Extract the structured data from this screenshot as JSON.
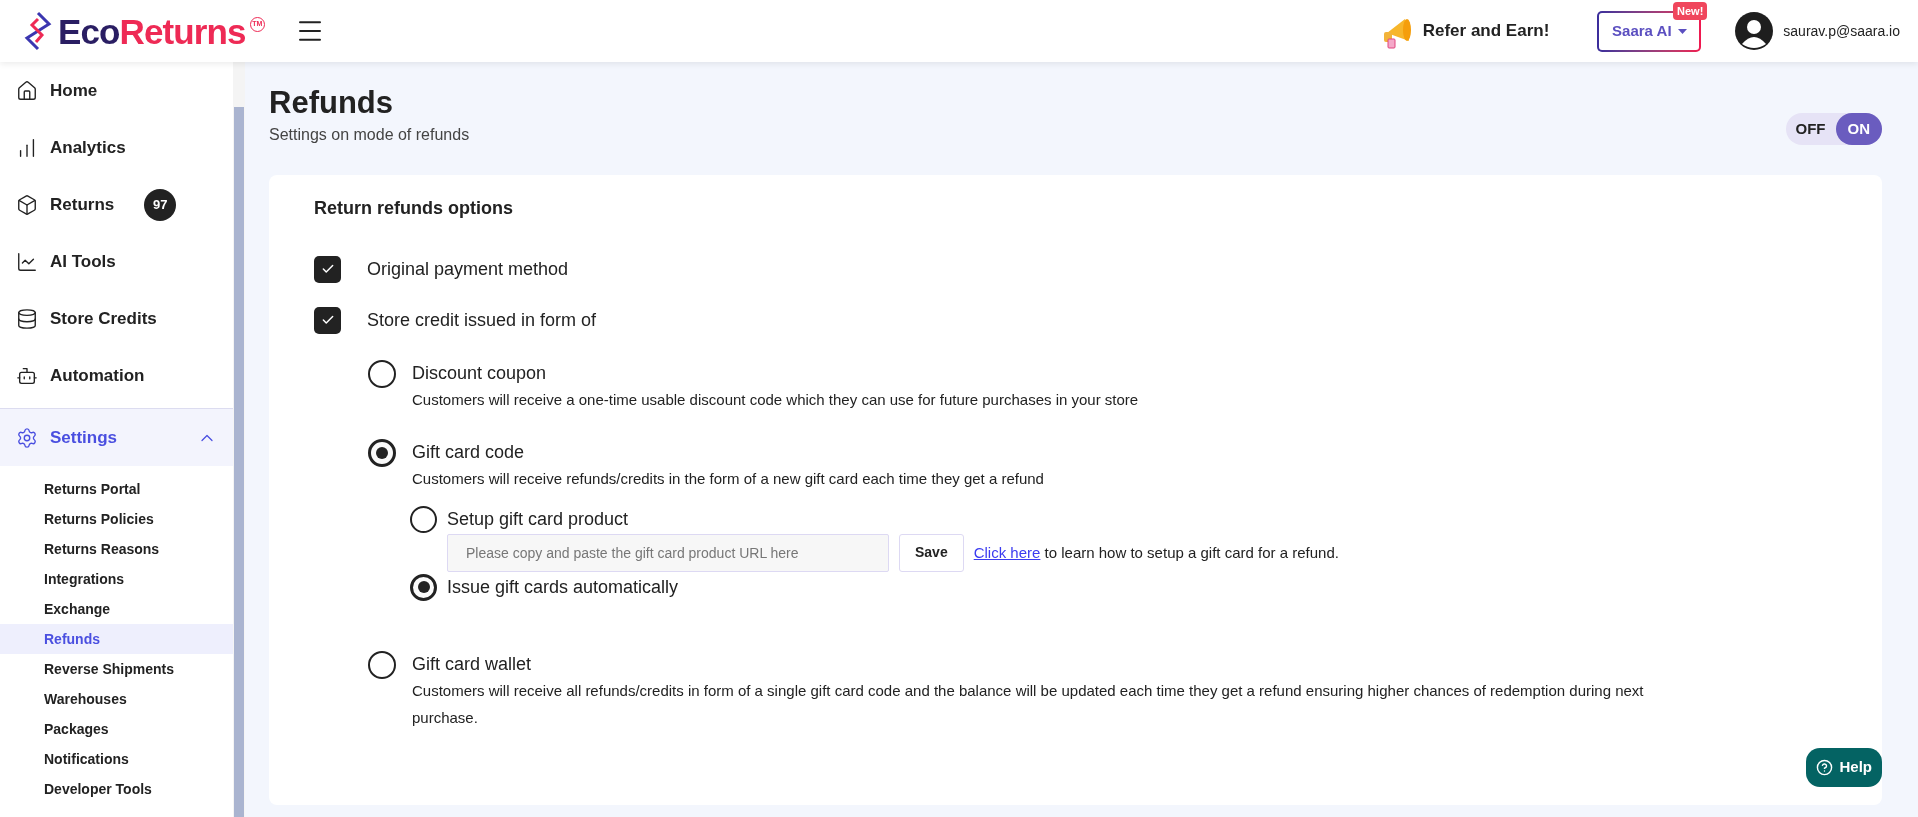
{
  "header": {
    "logo": {
      "first": "Eco",
      "second": "Returns",
      "mark": "TM"
    },
    "refer": "Refer and Earn!",
    "ai_button": {
      "label": "Saara AI",
      "badge": "New!"
    },
    "user": "saurav.p@saara.io"
  },
  "sidebar": {
    "items": [
      {
        "label": "Home",
        "selected": false
      },
      {
        "label": "Analytics",
        "selected": false
      },
      {
        "label": "Returns",
        "badge": "97",
        "selected": false
      },
      {
        "label": "AI Tools",
        "selected": false
      },
      {
        "label": "Store Credits",
        "selected": false
      },
      {
        "label": "Automation",
        "selected": false
      },
      {
        "label": "Settings",
        "selected": true,
        "expanded": true,
        "children": [
          {
            "label": "Returns Portal",
            "selected": false
          },
          {
            "label": "Returns Policies",
            "selected": false
          },
          {
            "label": "Returns Reasons",
            "selected": false
          },
          {
            "label": "Integrations",
            "selected": false
          },
          {
            "label": "Exchange",
            "selected": false
          },
          {
            "label": "Refunds",
            "selected": true
          },
          {
            "label": "Reverse Shipments",
            "selected": false
          },
          {
            "label": "Warehouses",
            "selected": false
          },
          {
            "label": "Packages",
            "selected": false
          },
          {
            "label": "Notifications",
            "selected": false
          },
          {
            "label": "Developer Tools",
            "selected": false
          }
        ]
      }
    ]
  },
  "page": {
    "title": "Refunds",
    "subtitle": "Settings on mode of refunds",
    "toggle": {
      "off_label": "OFF",
      "on_label": "ON",
      "on": true
    }
  },
  "card": {
    "title": "Return refunds options",
    "checkboxes": [
      {
        "label": "Original payment method",
        "checked": true
      },
      {
        "label": "Store credit issued in form of",
        "checked": true
      }
    ],
    "credit_forms": [
      {
        "label": "Discount coupon",
        "description": "Customers will receive a one-time usable discount code which they can use for future purchases in your store",
        "selected": false
      },
      {
        "label": "Gift card code",
        "description": "Customers will receive refunds/credits in the form of a new gift card each time they get a refund",
        "selected": true,
        "options": [
          {
            "label": "Setup gift card product",
            "selected": false,
            "field": {
              "placeholder": "Please copy and paste the gift card product URL here"
            },
            "save": "Save",
            "link": "Click here",
            "link_rest": "to learn how to setup a gift card for a refund."
          },
          {
            "label": "Issue gift cards automatically",
            "selected": true
          }
        ]
      },
      {
        "label": "Gift card wallet",
        "description": "Customers will receive all refunds/credits in form of a single gift card code and the balance will be updated each time they get a refund ensuring higher chances of redemption during next purchase.",
        "selected": false
      }
    ]
  },
  "help": "Help"
}
